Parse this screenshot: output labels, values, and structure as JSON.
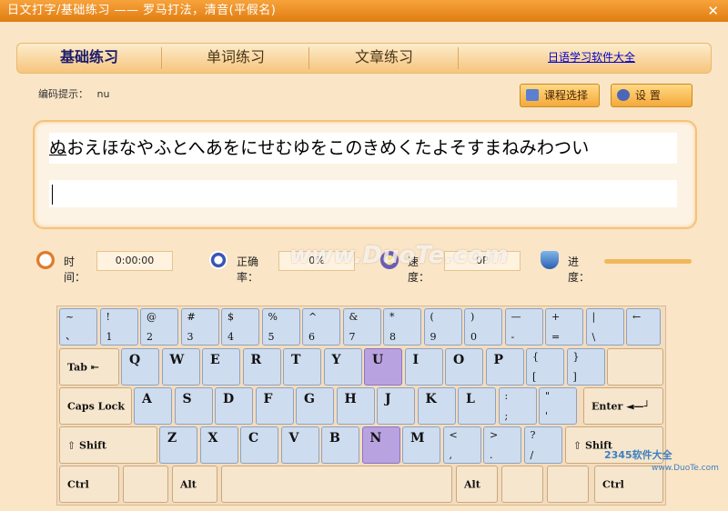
{
  "window": {
    "title": "日文打字/基础练习 ——  罗马打法，清音(平假名)",
    "close": "✕"
  },
  "tabs": [
    {
      "label": "基础练习",
      "active": true
    },
    {
      "label": "单词练习",
      "active": false
    },
    {
      "label": "文章练习",
      "active": false
    }
  ],
  "tab_link": "日语学习软件大全",
  "hint": {
    "label": "编码提示：",
    "value": "nu"
  },
  "buttons": {
    "course": "课程选择",
    "settings": "设 置"
  },
  "text": {
    "current_char": "ぬ",
    "rest": "おえほなやふとへあをにせむゆをこのきめくたよそすまねみわつい"
  },
  "stats": {
    "time_label": "时间：",
    "time_value": "0:00:00",
    "accuracy_label": "正确率：",
    "accuracy_value": "0%",
    "speed_label": "速度：",
    "speed_value": "0P",
    "progress_label": "进度：",
    "progress_value": 0
  },
  "watermark": "www.DuoTe.com",
  "watermark2": "2345软件大全",
  "watermark3": "www.DuoTe.com",
  "keyboard": {
    "row1": [
      {
        "t": "~",
        "b": "、"
      },
      {
        "t": "!",
        "b": "1"
      },
      {
        "t": "@",
        "b": "2"
      },
      {
        "t": "#",
        "b": "3"
      },
      {
        "t": "$",
        "b": "4"
      },
      {
        "t": "%",
        "b": "5"
      },
      {
        "t": "^",
        "b": "6"
      },
      {
        "t": "&",
        "b": "7"
      },
      {
        "t": "*",
        "b": "8"
      },
      {
        "t": "(",
        "b": "9"
      },
      {
        "t": ")",
        "b": "0"
      },
      {
        "t": "—",
        "b": "-"
      },
      {
        "t": "+",
        "b": "="
      },
      {
        "t": "|",
        "b": "\\"
      },
      {
        "t": "←",
        "b": ""
      }
    ],
    "row2": [
      "Q",
      "W",
      "E",
      "R",
      "T",
      "Y",
      "U",
      "I",
      "O",
      "P"
    ],
    "row2_extra": [
      {
        "t": "{",
        "b": "["
      },
      {
        "t": "}",
        "b": "]"
      }
    ],
    "row3": [
      "A",
      "S",
      "D",
      "F",
      "G",
      "H",
      "J",
      "K",
      "L"
    ],
    "row3_extra": [
      {
        "t": ":",
        "b": ";"
      },
      {
        "t": "\"",
        "b": "'"
      }
    ],
    "row4": [
      "Z",
      "X",
      "C",
      "V",
      "B",
      "N",
      "M"
    ],
    "row4_extra": [
      {
        "t": "<",
        "b": ","
      },
      {
        "t": ">",
        "b": "."
      },
      {
        "t": "?",
        "b": "/"
      }
    ],
    "tab": "Tab",
    "caps": "Caps Lock",
    "enter": "Enter ◄—┘",
    "lshift": "⇧ Shift",
    "rshift": "⇧ Shift",
    "lctrl": "Ctrl",
    "lalt": "Alt",
    "ralt": "Alt",
    "rctrl": "Ctrl",
    "highlighted": [
      "U",
      "N"
    ]
  }
}
